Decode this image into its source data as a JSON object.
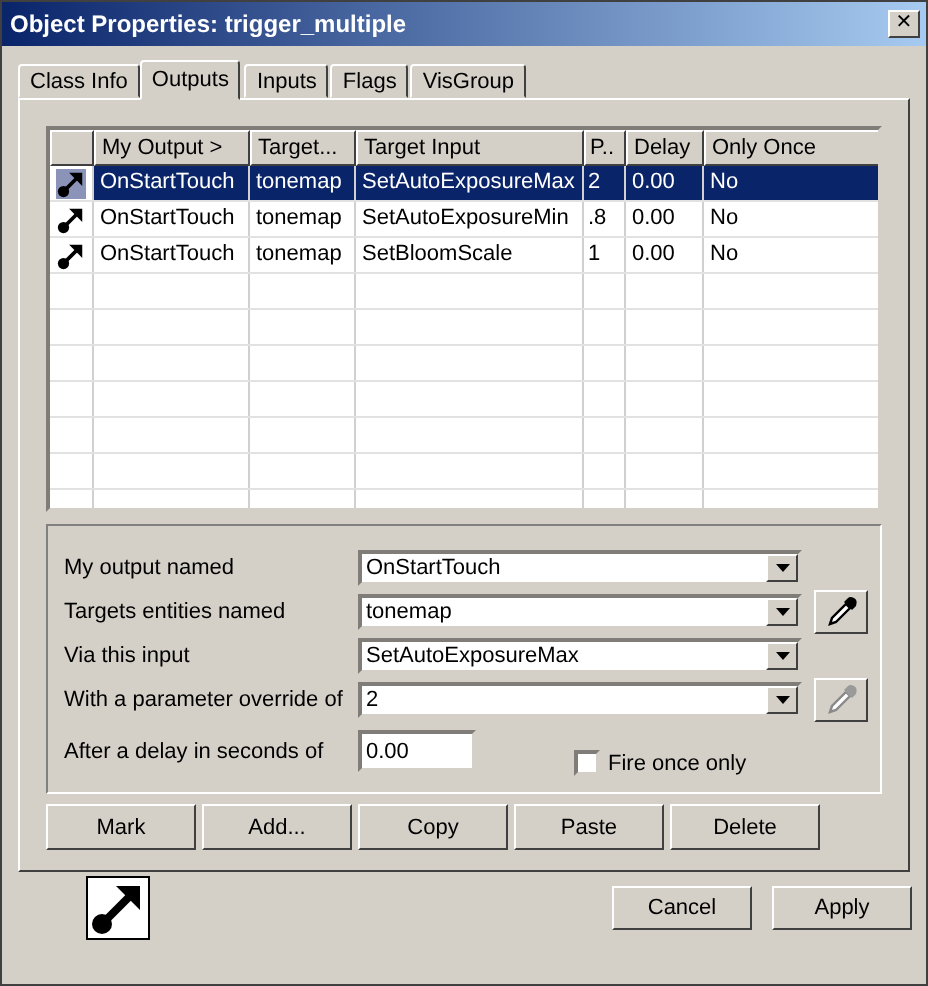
{
  "window": {
    "title": "Object Properties: trigger_multiple",
    "close": "✕"
  },
  "tabs": [
    {
      "label": "Class Info",
      "selected": false
    },
    {
      "label": "Outputs",
      "selected": true
    },
    {
      "label": "Inputs",
      "selected": false
    },
    {
      "label": "Flags",
      "selected": false
    },
    {
      "label": "VisGroup",
      "selected": false
    }
  ],
  "table": {
    "columns": [
      "My Output >",
      "Target...",
      "Target Input",
      "P..",
      "Delay",
      "Only Once"
    ],
    "rows": [
      {
        "selected": true,
        "cells": [
          "OnStartTouch",
          "tonemap",
          "SetAutoExposureMax",
          "2",
          "0.00",
          "No"
        ]
      },
      {
        "selected": false,
        "cells": [
          "OnStartTouch",
          "tonemap",
          "SetAutoExposureMin",
          ".8",
          "0.00",
          "No"
        ]
      },
      {
        "selected": false,
        "cells": [
          "OnStartTouch",
          "tonemap",
          "SetBloomScale",
          "1",
          "0.00",
          "No"
        ]
      }
    ]
  },
  "form": {
    "fields": [
      {
        "label": "My output named",
        "value": "OnStartTouch"
      },
      {
        "label": "Targets entities named",
        "value": "tonemap",
        "eyedropper": {
          "disabled": false
        }
      },
      {
        "label": "Via this input",
        "value": "SetAutoExposureMax"
      },
      {
        "label": "With a parameter override of",
        "value": "2",
        "eyedropper": {
          "disabled": true
        }
      }
    ],
    "delay": {
      "label": "After a delay in seconds of",
      "value": "0.00"
    },
    "fire_once": {
      "label": "Fire once only",
      "checked": false
    }
  },
  "actions": [
    "Mark",
    "Add...",
    "Copy",
    "Paste",
    "Delete"
  ],
  "buttons": [
    "Cancel",
    "Apply"
  ]
}
